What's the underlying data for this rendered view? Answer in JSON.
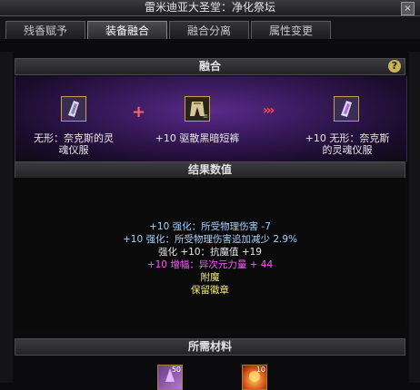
{
  "window": {
    "title": "雷米迪亚大圣堂：净化祭坛",
    "close_glyph": "×"
  },
  "tabs": [
    {
      "label": "残香赋予"
    },
    {
      "label": "装备融合"
    },
    {
      "label": "融合分离"
    },
    {
      "label": "属性变更"
    }
  ],
  "fusion": {
    "header": "融合",
    "help_glyph": "?",
    "plus": "+",
    "arrows": "›››",
    "items": [
      {
        "name_line1": "无形：奈克斯的灵",
        "name_line2": "魂仪服",
        "icon": "armor-icon"
      },
      {
        "name_line1": "+10 驱散黑暗短裤",
        "name_line2": "",
        "icon": "pants-icon",
        "badge": "≡"
      },
      {
        "name_line1": "+10 无形：奈克斯",
        "name_line2": "的灵魂仪服",
        "icon": "armor-icon"
      }
    ]
  },
  "results": {
    "header": "结果数值",
    "lines": [
      {
        "text": "+10 强化：所受物理伤害 -7",
        "color": "blue"
      },
      {
        "text": "+10 强化：所受物理伤害追加减少 2.9%",
        "color": "blue"
      },
      {
        "text": "强化 +10：抗魔值 +19",
        "color": "white"
      },
      {
        "text": "+10  增幅：异次元力量 + 44",
        "color": "magenta"
      },
      {
        "text": "附魔",
        "color": "yellow"
      },
      {
        "text": "保留徽章",
        "color": "yellow"
      }
    ]
  },
  "materials": {
    "header": "所需材料",
    "items": [
      {
        "count": "50",
        "icon": "crystal-icon"
      },
      {
        "count": "10",
        "icon": "fire-orb-icon"
      }
    ]
  },
  "colors": {
    "gold_border": "#c4a24a",
    "stat_blue": "#9fd1ff",
    "stat_magenta": "#ff58ff",
    "stat_yellow": "#f2ef6c",
    "accent_red": "#ff4d4d"
  }
}
